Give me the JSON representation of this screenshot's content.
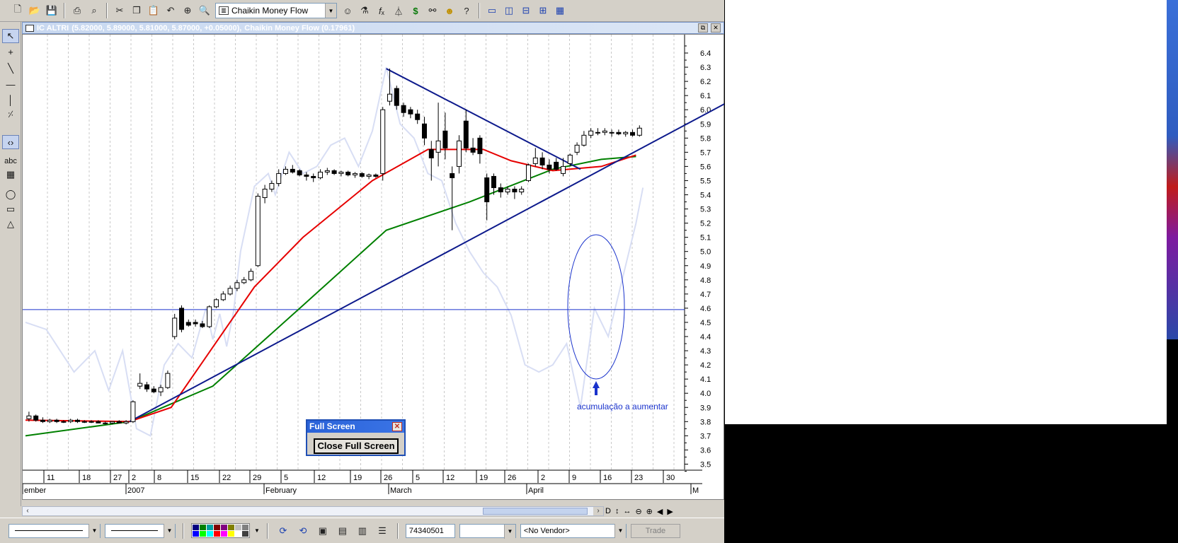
{
  "window": {
    "symbol": "IC ALTRI",
    "ohlc": "(5.82000, 5.89000, 5.81000, 5.87000, +0.05000),",
    "indicator_readout": "Chaikin Money Flow (0.17961)"
  },
  "toolbar": {
    "indicator_select": "Chaikin Money Flow",
    "icons": [
      "new-icon",
      "open-icon",
      "save-icon",
      "print-icon",
      "print-preview-icon",
      "cut-icon",
      "copy-icon",
      "paste-icon",
      "undo-icon",
      "crosshair-icon",
      "zoom-icon",
      "expert-icon",
      "function-icon",
      "indicator-icon",
      "dollar-icon",
      "binoculars-icon",
      "help-icon",
      "window-icon",
      "tile-vertical-icon",
      "tile-horizontal-icon",
      "tile-grid-icon",
      "layout-icon"
    ]
  },
  "left_tools": [
    "pointer",
    "crosshair",
    "trendline",
    "horizontal-line",
    "vertical-line",
    "fibonacci",
    "zoom-arrows",
    "text",
    "grid",
    "ellipse",
    "rectangle",
    "triangle"
  ],
  "left_tool_text_label": "abc",
  "chart": {
    "y_ticks": [
      "6.4",
      "6.3",
      "6.2",
      "6.1",
      "6.0",
      "5.9",
      "5.8",
      "5.7",
      "5.6",
      "5.5",
      "5.4",
      "5.3",
      "5.2",
      "5.1",
      "5.0",
      "4.9",
      "4.8",
      "4.7",
      "4.6",
      "4.5",
      "4.4",
      "4.3",
      "4.2",
      "4.1",
      "4.0",
      "3.9",
      "3.8",
      "3.7",
      "3.6",
      "3.5"
    ],
    "x_day_ticks": [
      "11",
      "18",
      "27",
      "2",
      "8",
      "15",
      "22",
      "29",
      "5",
      "12",
      "19",
      "26",
      "5",
      "12",
      "19",
      "26",
      "2",
      "9",
      "16",
      "23",
      "30"
    ],
    "x_month_labels": [
      "ember",
      "2007",
      "February",
      "March",
      "April",
      "M"
    ],
    "annotation": "acumulação a aumentar"
  },
  "chart_data": {
    "type": "candlestick",
    "title": "IC ALTRI",
    "ylim": [
      3.45,
      6.47
    ],
    "x_axis": "date",
    "last_close": 5.87,
    "candles": [
      {
        "date": "2006-12-05",
        "o": 3.82,
        "h": 3.87,
        "l": 3.8,
        "c": 3.84
      },
      {
        "date": "2006-12-06",
        "o": 3.84,
        "h": 3.85,
        "l": 3.8,
        "c": 3.81
      },
      {
        "date": "2006-12-07",
        "o": 3.81,
        "h": 3.83,
        "l": 3.79,
        "c": 3.8
      },
      {
        "date": "2006-12-08",
        "o": 3.8,
        "h": 3.82,
        "l": 3.79,
        "c": 3.81
      },
      {
        "date": "2006-12-11",
        "o": 3.81,
        "h": 3.82,
        "l": 3.79,
        "c": 3.8
      },
      {
        "date": "2006-12-12",
        "o": 3.8,
        "h": 3.81,
        "l": 3.79,
        "c": 3.8
      },
      {
        "date": "2006-12-13",
        "o": 3.8,
        "h": 3.82,
        "l": 3.79,
        "c": 3.81
      },
      {
        "date": "2006-12-14",
        "o": 3.81,
        "h": 3.82,
        "l": 3.79,
        "c": 3.8
      },
      {
        "date": "2006-12-15",
        "o": 3.8,
        "h": 3.81,
        "l": 3.79,
        "c": 3.8
      },
      {
        "date": "2006-12-18",
        "o": 3.8,
        "h": 3.81,
        "l": 3.79,
        "c": 3.8
      },
      {
        "date": "2006-12-19",
        "o": 3.8,
        "h": 3.81,
        "l": 3.79,
        "c": 3.79
      },
      {
        "date": "2006-12-20",
        "o": 3.79,
        "h": 3.8,
        "l": 3.78,
        "c": 3.79
      },
      {
        "date": "2006-12-21",
        "o": 3.79,
        "h": 3.8,
        "l": 3.78,
        "c": 3.8
      },
      {
        "date": "2006-12-22",
        "o": 3.8,
        "h": 3.81,
        "l": 3.79,
        "c": 3.79
      },
      {
        "date": "2006-12-27",
        "o": 3.79,
        "h": 3.81,
        "l": 3.78,
        "c": 3.8
      },
      {
        "date": "2006-12-28",
        "o": 3.8,
        "h": 3.95,
        "l": 3.79,
        "c": 3.94
      },
      {
        "date": "2006-12-29",
        "o": 4.05,
        "h": 4.14,
        "l": 4.03,
        "c": 4.07
      },
      {
        "date": "2007-01-02",
        "o": 4.06,
        "h": 4.08,
        "l": 4.01,
        "c": 4.03
      },
      {
        "date": "2007-01-03",
        "o": 4.03,
        "h": 4.05,
        "l": 4.0,
        "c": 4.01
      },
      {
        "date": "2007-01-04",
        "o": 4.01,
        "h": 4.06,
        "l": 3.98,
        "c": 4.04
      },
      {
        "date": "2007-01-05",
        "o": 4.04,
        "h": 4.16,
        "l": 4.03,
        "c": 4.14
      },
      {
        "date": "2007-01-08",
        "o": 4.4,
        "h": 4.56,
        "l": 4.38,
        "c": 4.53
      },
      {
        "date": "2007-01-09",
        "o": 4.6,
        "h": 4.62,
        "l": 4.43,
        "c": 4.45
      },
      {
        "date": "2007-01-10",
        "o": 4.5,
        "h": 4.52,
        "l": 4.47,
        "c": 4.48
      },
      {
        "date": "2007-01-11",
        "o": 4.5,
        "h": 4.52,
        "l": 4.47,
        "c": 4.49
      },
      {
        "date": "2007-01-12",
        "o": 4.49,
        "h": 4.51,
        "l": 4.46,
        "c": 4.47
      },
      {
        "date": "2007-01-15",
        "o": 4.47,
        "h": 4.62,
        "l": 4.46,
        "c": 4.61
      },
      {
        "date": "2007-01-16",
        "o": 4.61,
        "h": 4.67,
        "l": 4.6,
        "c": 4.66
      },
      {
        "date": "2007-01-17",
        "o": 4.66,
        "h": 4.72,
        "l": 4.65,
        "c": 4.7
      },
      {
        "date": "2007-01-18",
        "o": 4.7,
        "h": 4.76,
        "l": 4.69,
        "c": 4.74
      },
      {
        "date": "2007-01-19",
        "o": 4.74,
        "h": 4.8,
        "l": 4.72,
        "c": 4.78
      },
      {
        "date": "2007-01-22",
        "o": 4.78,
        "h": 4.82,
        "l": 4.77,
        "c": 4.8
      },
      {
        "date": "2007-01-23",
        "o": 4.8,
        "h": 4.88,
        "l": 4.79,
        "c": 4.86
      },
      {
        "date": "2007-01-24",
        "o": 4.9,
        "h": 5.41,
        "l": 4.89,
        "c": 5.39
      },
      {
        "date": "2007-01-25",
        "o": 5.38,
        "h": 5.47,
        "l": 5.34,
        "c": 5.44
      },
      {
        "date": "2007-01-26",
        "o": 5.44,
        "h": 5.5,
        "l": 5.42,
        "c": 5.48
      },
      {
        "date": "2007-01-29",
        "o": 5.48,
        "h": 5.58,
        "l": 5.46,
        "c": 5.55
      },
      {
        "date": "2007-01-30",
        "o": 5.55,
        "h": 5.6,
        "l": 5.54,
        "c": 5.58
      },
      {
        "date": "2007-01-31",
        "o": 5.58,
        "h": 5.61,
        "l": 5.55,
        "c": 5.56
      },
      {
        "date": "2007-02-01",
        "o": 5.57,
        "h": 5.58,
        "l": 5.53,
        "c": 5.54
      },
      {
        "date": "2007-02-02",
        "o": 5.54,
        "h": 5.56,
        "l": 5.5,
        "c": 5.53
      },
      {
        "date": "2007-02-05",
        "o": 5.53,
        "h": 5.55,
        "l": 5.49,
        "c": 5.52
      },
      {
        "date": "2007-02-06",
        "o": 5.52,
        "h": 5.58,
        "l": 5.51,
        "c": 5.56
      },
      {
        "date": "2007-02-07",
        "o": 5.56,
        "h": 5.59,
        "l": 5.54,
        "c": 5.57
      },
      {
        "date": "2007-02-08",
        "o": 5.57,
        "h": 5.58,
        "l": 5.54,
        "c": 5.55
      },
      {
        "date": "2007-02-09",
        "o": 5.55,
        "h": 5.57,
        "l": 5.53,
        "c": 5.56
      },
      {
        "date": "2007-02-12",
        "o": 5.56,
        "h": 5.57,
        "l": 5.53,
        "c": 5.54
      },
      {
        "date": "2007-02-13",
        "o": 5.54,
        "h": 5.56,
        "l": 5.52,
        "c": 5.55
      },
      {
        "date": "2007-02-14",
        "o": 5.55,
        "h": 5.56,
        "l": 5.52,
        "c": 5.53
      },
      {
        "date": "2007-02-15",
        "o": 5.53,
        "h": 5.55,
        "l": 5.51,
        "c": 5.54
      },
      {
        "date": "2007-02-16",
        "o": 5.54,
        "h": 5.55,
        "l": 5.52,
        "c": 5.53
      },
      {
        "date": "2007-02-19",
        "o": 5.55,
        "h": 6.02,
        "l": 5.5,
        "c": 6.0
      },
      {
        "date": "2007-02-20",
        "o": 6.06,
        "h": 6.29,
        "l": 6.03,
        "c": 6.11
      },
      {
        "date": "2007-02-21",
        "o": 6.15,
        "h": 6.17,
        "l": 6.0,
        "c": 6.03
      },
      {
        "date": "2007-02-22",
        "o": 6.03,
        "h": 6.05,
        "l": 5.95,
        "c": 5.98
      },
      {
        "date": "2007-02-23",
        "o": 6.0,
        "h": 6.02,
        "l": 5.94,
        "c": 5.97
      },
      {
        "date": "2007-02-26",
        "o": 5.97,
        "h": 6.0,
        "l": 5.9,
        "c": 5.93
      },
      {
        "date": "2007-02-27",
        "o": 5.9,
        "h": 5.95,
        "l": 5.75,
        "c": 5.8
      },
      {
        "date": "2007-02-28",
        "o": 5.72,
        "h": 5.78,
        "l": 5.5,
        "c": 5.66
      },
      {
        "date": "2007-03-01",
        "o": 5.7,
        "h": 6.05,
        "l": 5.6,
        "c": 5.78
      },
      {
        "date": "2007-03-02",
        "o": 5.85,
        "h": 5.98,
        "l": 5.65,
        "c": 5.73
      },
      {
        "date": "2007-03-05",
        "o": 5.55,
        "h": 5.6,
        "l": 5.15,
        "c": 5.52
      },
      {
        "date": "2007-03-06",
        "o": 5.6,
        "h": 5.82,
        "l": 5.55,
        "c": 5.78
      },
      {
        "date": "2007-03-07",
        "o": 5.92,
        "h": 6.0,
        "l": 5.7,
        "c": 5.73
      },
      {
        "date": "2007-03-08",
        "o": 5.73,
        "h": 5.8,
        "l": 5.68,
        "c": 5.7
      },
      {
        "date": "2007-03-09",
        "o": 5.8,
        "h": 5.82,
        "l": 5.62,
        "c": 5.69
      },
      {
        "date": "2007-03-12",
        "o": 5.52,
        "h": 5.55,
        "l": 5.22,
        "c": 5.35
      },
      {
        "date": "2007-03-13",
        "o": 5.53,
        "h": 5.55,
        "l": 5.4,
        "c": 5.45
      },
      {
        "date": "2007-03-14",
        "o": 5.45,
        "h": 5.48,
        "l": 5.38,
        "c": 5.42
      },
      {
        "date": "2007-03-15",
        "o": 5.42,
        "h": 5.46,
        "l": 5.4,
        "c": 5.44
      },
      {
        "date": "2007-03-16",
        "o": 5.44,
        "h": 5.46,
        "l": 5.37,
        "c": 5.42
      },
      {
        "date": "2007-03-19",
        "o": 5.42,
        "h": 5.46,
        "l": 5.4,
        "c": 5.44
      },
      {
        "date": "2007-03-20",
        "o": 5.5,
        "h": 5.62,
        "l": 5.49,
        "c": 5.61
      },
      {
        "date": "2007-03-21",
        "o": 5.62,
        "h": 5.73,
        "l": 5.6,
        "c": 5.66
      },
      {
        "date": "2007-03-22",
        "o": 5.66,
        "h": 5.7,
        "l": 5.58,
        "c": 5.61
      },
      {
        "date": "2007-03-23",
        "o": 5.61,
        "h": 5.65,
        "l": 5.55,
        "c": 5.58
      },
      {
        "date": "2007-03-26",
        "o": 5.63,
        "h": 5.66,
        "l": 5.57,
        "c": 5.58
      },
      {
        "date": "2007-03-27",
        "o": 5.55,
        "h": 5.66,
        "l": 5.53,
        "c": 5.6
      },
      {
        "date": "2007-03-28",
        "o": 5.62,
        "h": 5.69,
        "l": 5.6,
        "c": 5.68
      },
      {
        "date": "2007-03-29",
        "o": 5.7,
        "h": 5.77,
        "l": 5.68,
        "c": 5.75
      },
      {
        "date": "2007-03-30",
        "o": 5.75,
        "h": 5.85,
        "l": 5.74,
        "c": 5.82
      },
      {
        "date": "2007-04-02",
        "o": 5.82,
        "h": 5.87,
        "l": 5.8,
        "c": 5.85
      },
      {
        "date": "2007-04-03",
        "o": 5.84,
        "h": 5.87,
        "l": 5.82,
        "c": 5.84
      },
      {
        "date": "2007-04-04",
        "o": 5.84,
        "h": 5.87,
        "l": 5.82,
        "c": 5.85
      },
      {
        "date": "2007-04-05",
        "o": 5.84,
        "h": 5.86,
        "l": 5.81,
        "c": 5.84
      },
      {
        "date": "2007-04-10",
        "o": 5.84,
        "h": 5.86,
        "l": 5.82,
        "c": 5.83
      },
      {
        "date": "2007-04-11",
        "o": 5.83,
        "h": 5.85,
        "l": 5.81,
        "c": 5.84
      },
      {
        "date": "2007-04-12",
        "o": 5.84,
        "h": 5.86,
        "l": 5.81,
        "c": 5.82
      },
      {
        "date": "2007-04-13",
        "o": 5.82,
        "h": 5.89,
        "l": 5.81,
        "c": 5.87
      }
    ],
    "ma_red": [
      [
        0,
        3.81
      ],
      [
        15,
        3.8
      ],
      [
        21,
        3.9
      ],
      [
        33,
        4.75
      ],
      [
        40,
        5.1
      ],
      [
        50,
        5.5
      ],
      [
        58,
        5.72
      ],
      [
        66,
        5.72
      ],
      [
        70,
        5.64
      ],
      [
        76,
        5.57
      ],
      [
        83,
        5.6
      ],
      [
        88,
        5.68
      ]
    ],
    "ma_green": [
      [
        0,
        3.7
      ],
      [
        15,
        3.8
      ],
      [
        27,
        4.05
      ],
      [
        40,
        4.62
      ],
      [
        52,
        5.15
      ],
      [
        64,
        5.35
      ],
      [
        76,
        5.58
      ],
      [
        83,
        5.65
      ],
      [
        88,
        5.67
      ]
    ],
    "hline": 4.59,
    "trendlines": [
      {
        "from": [
          15,
          3.8
        ],
        "to": [
          103,
          6.1
        ]
      },
      {
        "from": [
          52,
          6.29
        ],
        "to": [
          80,
          5.58
        ]
      }
    ]
  },
  "bottom_toolbar": {
    "account_id": "74340501",
    "vendor": "<No Vendor>",
    "trade_label": "Trade",
    "palette_colors": [
      "#000080",
      "#008000",
      "#00a0a0",
      "#800000",
      "#800080",
      "#808000",
      "#c0c0c0",
      "#808080",
      "#0000ff",
      "#00ff00",
      "#00ffff",
      "#ff0000",
      "#ff00ff",
      "#ffff00",
      "#ffffff",
      "#404040"
    ]
  },
  "fullscreen_dialog": {
    "title": "Full Screen",
    "button": "Close Full Screen"
  },
  "nav_controls": [
    "D",
    "↕",
    "↔",
    "⊖",
    "⊕",
    "◀",
    "▶"
  ],
  "colors": {
    "title_bar": "#c8d8f0",
    "ma_red": "#e60000",
    "ma_green": "#008000",
    "trendline": "#0d1a8c",
    "hline": "#1a33cc",
    "money_flow": "#d8def4"
  }
}
